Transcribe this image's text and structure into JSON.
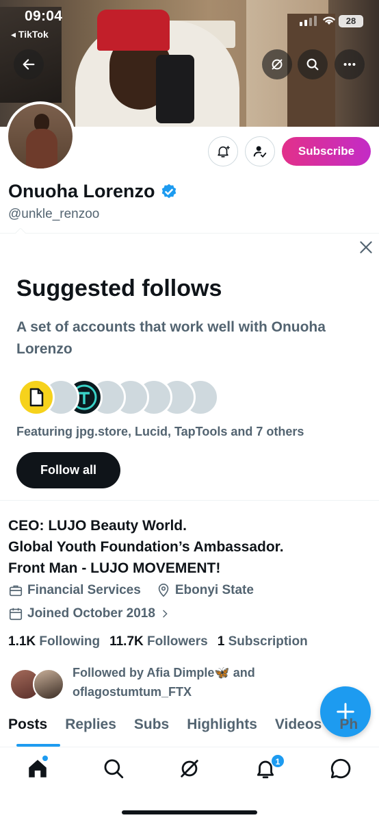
{
  "status_bar": {
    "time": "09:04",
    "back_app": "◂ TikTok",
    "battery": "28"
  },
  "profile": {
    "name": "Onuoha Lorenzo",
    "handle": "@unkle_renzoo",
    "subscribe_label": "Subscribe"
  },
  "suggested": {
    "title": "Suggested follows",
    "subtitle": "A set of accounts that work well with Onuoha Lorenzo",
    "featuring": "Featuring jpg.store, Lucid, TapTools and 7 others",
    "follow_all_label": "Follow all"
  },
  "bio": {
    "line1": "CEO: LUJO Beauty World.",
    "line2": "Global Youth Foundation’s Ambassador.",
    "line3": "Front Man - LUJO MOVEMENT!"
  },
  "meta": {
    "category": "Financial Services",
    "location": "Ebonyi State",
    "joined": "Joined October 2018"
  },
  "counts": {
    "following_value": "1.1K",
    "following_label": "Following",
    "followers_value": "11.7K",
    "followers_label": "Followers",
    "subscription_value": "1",
    "subscription_label": "Subscription"
  },
  "followed_by": {
    "prefix": "Followed by Afia Dimple",
    "emoji": "🦋",
    "suffix": " and oflagostumtum_FTX"
  },
  "tabs": [
    "Posts",
    "Replies",
    "Subs",
    "Highlights",
    "Videos",
    "Ph"
  ],
  "nav": {
    "notification_count": "1"
  },
  "colors": {
    "accent": "#1d9bf0",
    "subscribe_start": "#e2308a",
    "subscribe_end": "#c32cc6",
    "text_secondary": "#536471"
  },
  "icons": [
    "back-arrow-icon",
    "grok-icon",
    "search-icon",
    "more-icon",
    "notification-bell-icon",
    "user-check-icon",
    "verified-badge-icon",
    "close-icon",
    "briefcase-icon",
    "location-pin-icon",
    "calendar-icon",
    "chevron-right-icon",
    "plus-icon",
    "home-icon",
    "search-icon",
    "grok-icon",
    "bell-icon",
    "messages-icon"
  ]
}
